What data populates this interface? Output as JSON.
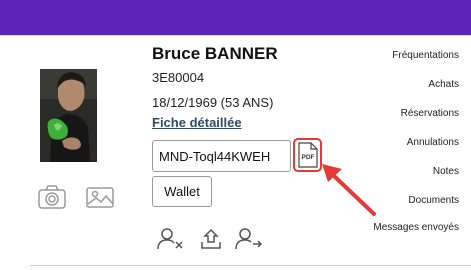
{
  "theme": {
    "accent": "#5a24b8",
    "alert": "#e53935",
    "link": "#2d4b66"
  },
  "client": {
    "name": "Bruce BANNER",
    "code": "3E80004",
    "dob": "18/12/1969 (53 ANS)",
    "details_link": "Fiche détaillée",
    "token_button": "MND-Toql44KWEH",
    "wallet_button": "Wallet",
    "pdf_icon_label": "PDF"
  },
  "photo": {
    "icons": [
      "camera-icon",
      "image-icon"
    ]
  },
  "actions": {
    "icons": [
      "remove-user-icon",
      "upload-icon",
      "transfer-user-icon"
    ]
  },
  "menu": {
    "items": [
      "Fréquentations",
      "Achats",
      "Réservations",
      "Annulations",
      "Notes",
      "Documents",
      "Messages envoyés"
    ]
  }
}
